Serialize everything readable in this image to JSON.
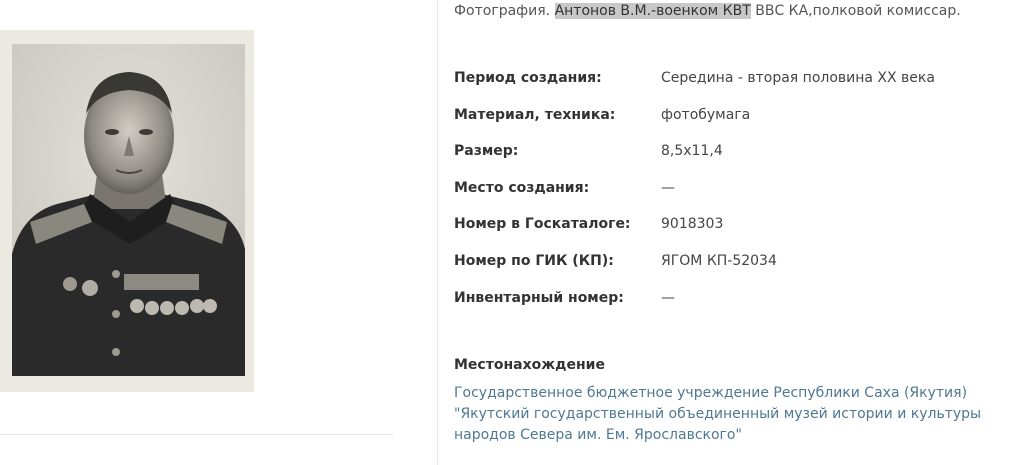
{
  "image": {
    "alt": "portrait-photograph"
  },
  "title": {
    "prefix": "Фотография. ",
    "highlight": "Антонов В.М.-военком КВТ",
    "suffix": " ВВС КА,полковой комиссар."
  },
  "properties": [
    {
      "label": "Период создания:",
      "value": "Середина - вторая половина XX века"
    },
    {
      "label": "Материал, техника:",
      "value": "фотобумага"
    },
    {
      "label": "Размер:",
      "value": "8,5x11,4"
    },
    {
      "label": "Место создания:",
      "value": "—"
    },
    {
      "label": "Номер в Госкаталоге:",
      "value": "9018303"
    },
    {
      "label": "Номер по ГИК (КП):",
      "value": "ЯГОМ КП-52034"
    },
    {
      "label": "Инвентарный номер:",
      "value": "—"
    }
  ],
  "location": {
    "label": "Местонахождение",
    "lines": [
      "Государственное бюджетное учреждение Республики Саха (Якутия)",
      "\"Якутский государственный объединенный музей истории и культуры",
      "народов Севера им. Ем. Ярославского\""
    ],
    "link_color": "#4f7891"
  }
}
